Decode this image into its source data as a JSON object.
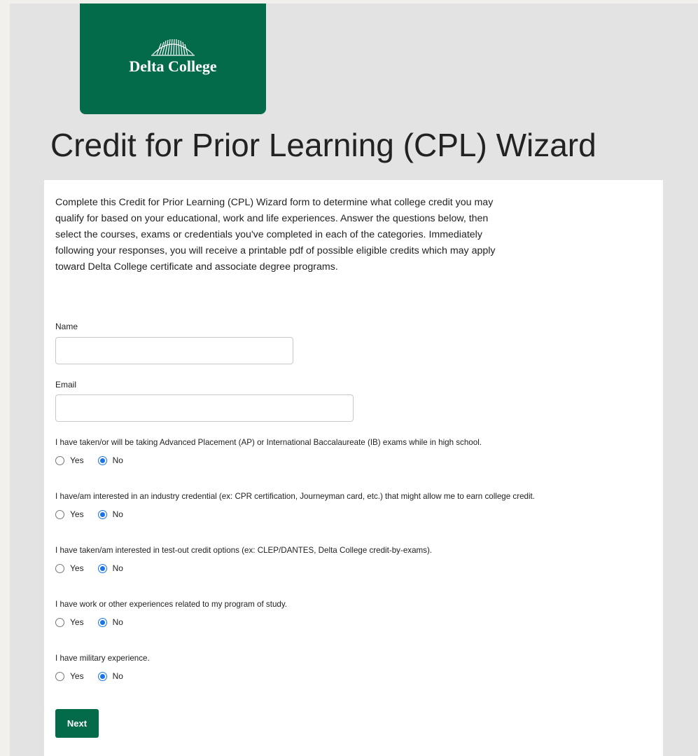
{
  "brand": {
    "name": "Delta College",
    "green": "#036a4a"
  },
  "page_title": "Credit for Prior Learning (CPL) Wizard",
  "intro_text": "Complete this Credit for Prior Learning (CPL) Wizard form to determine what college credit you may qualify for based on your educational, work and life experiences. Answer the questions below, then select the courses, exams or credentials you've completed in each of the categories. Immediately following your responses, you will receive a printable pdf of possible eligible credits which may apply toward Delta College certificate and associate degree programs.",
  "form": {
    "name_label": "Name",
    "name_value": "",
    "email_label": "Email",
    "email_value": "",
    "questions": [
      {
        "text": "I have taken/or will be taking Advanced Placement (AP) or International Baccalaureate (IB) exams while in high school.",
        "yes": "Yes",
        "no": "No",
        "selected": "No"
      },
      {
        "text": "I have/am interested in an industry credential (ex: CPR certification, Journeyman card, etc.) that might allow me to earn college credit.",
        "yes": "Yes",
        "no": "No",
        "selected": "No"
      },
      {
        "text": "I have taken/am interested in test-out credit options (ex: CLEP/DANTES, Delta College credit-by-exams).",
        "yes": "Yes",
        "no": "No",
        "selected": "No"
      },
      {
        "text": "I have work or other experiences related to my program of study.",
        "yes": "Yes",
        "no": "No",
        "selected": "No"
      },
      {
        "text": "I have military experience.",
        "yes": "Yes",
        "no": "No",
        "selected": "No"
      }
    ],
    "next_label": "Next"
  }
}
